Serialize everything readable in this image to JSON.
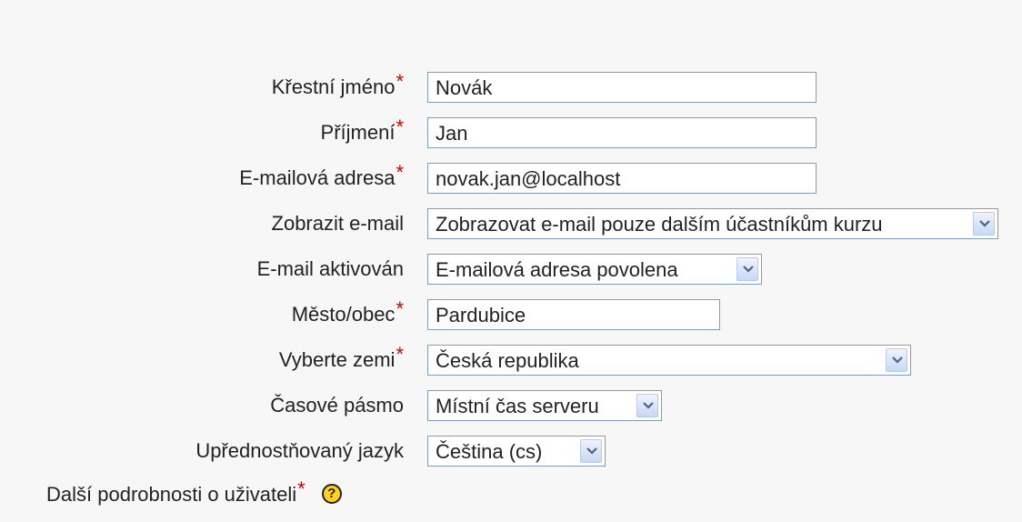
{
  "fields": {
    "first_name": {
      "label": "Křestní jméno",
      "required": "*",
      "value": "Novák"
    },
    "last_name": {
      "label": "Příjmení",
      "required": "*",
      "value": "Jan"
    },
    "email": {
      "label": "E-mailová adresa",
      "required": "*",
      "value": "novak.jan@localhost"
    },
    "display_email": {
      "label": "Zobrazit e-mail",
      "value": "Zobrazovat e-mail pouze dalším účastníkům kurzu"
    },
    "email_enabled": {
      "label": "E-mail aktivován",
      "value": "E-mailová adresa povolena"
    },
    "city": {
      "label": "Město/obec",
      "required": "*",
      "value": "Pardubice"
    },
    "country": {
      "label": "Vyberte zemi",
      "required": "*",
      "value": "Česká republika"
    },
    "timezone": {
      "label": "Časové pásmo",
      "value": "Místní čas serveru"
    },
    "language": {
      "label": "Upřednostňovaný jazyk",
      "value": "Čeština (cs)"
    }
  },
  "description": {
    "label": "Další podrobnosti o uživateli",
    "required": "*",
    "help_icon": "?"
  },
  "colors": {
    "required": "#d00000",
    "input_border": "#7f9db9",
    "help_icon": "#ffd21f"
  }
}
